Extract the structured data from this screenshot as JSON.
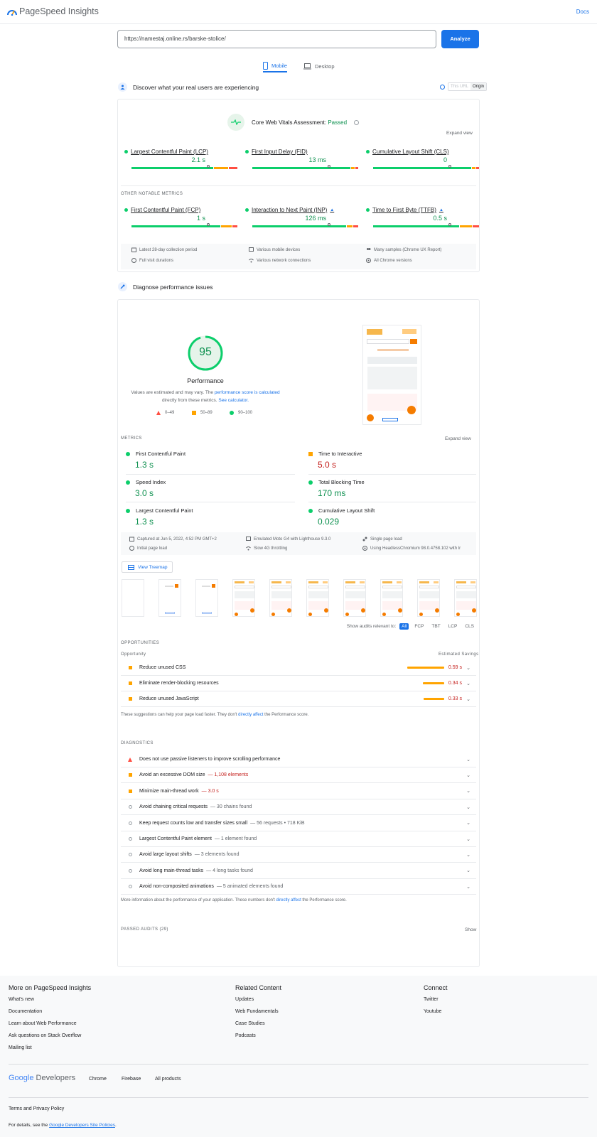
{
  "header": {
    "title": "PageSpeed Insights",
    "docs_label": "Docs"
  },
  "search": {
    "url": "https://namestaj.online.rs/barske-stolice/",
    "analyze_label": "Analyze"
  },
  "device_tabs": [
    {
      "label": "Mobile",
      "active": true
    },
    {
      "label": "Desktop",
      "active": false
    }
  ],
  "field": {
    "title": "Discover what your real users are experiencing",
    "toggle": {
      "this_url": "This URL",
      "origin": "Origin"
    },
    "assessment_label": "Core Web Vitals Assessment:",
    "assessment_result": "Passed",
    "expand_label": "Expand view",
    "core_metrics": [
      {
        "name": "Largest Contentful Paint (LCP)",
        "value": "2.1 s",
        "marker": 0.72,
        "dist": [
          0.78,
          0.14,
          0.08
        ]
      },
      {
        "name": "First Input Delay (FID)",
        "value": "13 ms",
        "marker": 0.72,
        "dist": [
          0.94,
          0.03,
          0.03
        ]
      },
      {
        "name": "Cumulative Layout Shift (CLS)",
        "value": "0",
        "marker": 0.72,
        "dist": [
          0.94,
          0.03,
          0.03
        ]
      }
    ],
    "other_label": "OTHER NOTABLE METRICS",
    "other_metrics": [
      {
        "name": "First Contentful Paint (FCP)",
        "value": "1 s",
        "marker": 0.72,
        "dist": [
          0.85,
          0.1,
          0.05
        ],
        "flag": false
      },
      {
        "name": "Interaction to Next Paint (INP)",
        "value": "126 ms",
        "marker": 0.72,
        "dist": [
          0.9,
          0.05,
          0.05
        ],
        "flag": true
      },
      {
        "name": "Time to First Byte (TTFB)",
        "value": "0.5 s",
        "marker": 0.72,
        "dist": [
          0.82,
          0.12,
          0.06
        ],
        "flag": true
      }
    ],
    "info": [
      "Latest 28-day collection period",
      "Various mobile devices",
      "Many samples (Chrome UX Report)",
      "Full visit durations",
      "Various network connections",
      "All Chrome versions"
    ]
  },
  "lab": {
    "title": "Diagnose performance issues",
    "score": "95",
    "score_fraction": 0.95,
    "score_label": "Performance",
    "note_a": "Values are estimated and may vary. The ",
    "note_link1": "performance score is calculated",
    "note_b": " directly from these metrics. ",
    "note_link2": "See calculator.",
    "legend": [
      "0–49",
      "50–89",
      "90–100"
    ],
    "metrics_label": "METRICS",
    "expand_label": "Expand view",
    "metrics": [
      {
        "name": "First Contentful Paint",
        "value": "1.3 s",
        "status": "good"
      },
      {
        "name": "Time to Interactive",
        "value": "5.0 s",
        "status": "average"
      },
      {
        "name": "Speed Index",
        "value": "3.0 s",
        "status": "good"
      },
      {
        "name": "Total Blocking Time",
        "value": "170 ms",
        "status": "good"
      },
      {
        "name": "Largest Contentful Paint",
        "value": "1.3 s",
        "status": "good"
      },
      {
        "name": "Cumulative Layout Shift",
        "value": "0.029",
        "status": "good"
      }
    ],
    "info": [
      "Captured at Jun 5, 2022, 4:52 PM GMT+2",
      "Emulated Moto G4 with Lighthouse 9.3.0",
      "Single page load",
      "Initial page load",
      "Slow 4G throttling",
      "Using HeadlessChromium 98.0.4758.102 with lr"
    ],
    "treemap_label": "View Treemap",
    "show_audits_label": "Show audits relevant to:",
    "audit_filters": [
      "All",
      "FCP",
      "TBT",
      "LCP",
      "CLS"
    ],
    "opportunities_label": "OPPORTUNITIES",
    "opp_col1": "Opportunity",
    "opp_col2": "Estimated Savings",
    "opportunities": [
      {
        "name": "Reduce unused CSS",
        "savings": "0.59 s",
        "bar": 0.59
      },
      {
        "name": "Eliminate render-blocking resources",
        "savings": "0.34 s",
        "bar": 0.34
      },
      {
        "name": "Reduce unused JavaScript",
        "savings": "0.33 s",
        "bar": 0.33
      }
    ],
    "opp_note_a": "These suggestions can help your page load faster. They don't ",
    "opp_note_link": "directly affect",
    "opp_note_b": " the Performance score.",
    "diagnostics_label": "DIAGNOSTICS",
    "diagnostics": [
      {
        "name": "Does not use passive listeners to improve scrolling performance",
        "detail": "",
        "status": "fail"
      },
      {
        "name": "Avoid an excessive DOM size",
        "detail": "— 1,108 elements",
        "status": "average"
      },
      {
        "name": "Minimize main-thread work",
        "detail": "— 3.0 s",
        "status": "average"
      },
      {
        "name": "Avoid chaining critical requests",
        "detail": "— 30 chains found",
        "status": "info"
      },
      {
        "name": "Keep request counts low and transfer sizes small",
        "detail": "— 56 requests • 718 KiB",
        "status": "info"
      },
      {
        "name": "Largest Contentful Paint element",
        "detail": "— 1 element found",
        "status": "info"
      },
      {
        "name": "Avoid large layout shifts",
        "detail": "— 3 elements found",
        "status": "info"
      },
      {
        "name": "Avoid long main-thread tasks",
        "detail": "— 4 long tasks found",
        "status": "info"
      },
      {
        "name": "Avoid non-composited animations",
        "detail": "— 5 animated elements found",
        "status": "info"
      }
    ],
    "diag_note_a": "More information about the performance of your application. These numbers don't ",
    "diag_note_link": "directly affect",
    "diag_note_b": " the Performance score.",
    "passed_label": "PASSED AUDITS (29)",
    "show_label": "Show"
  },
  "footer": {
    "col1": {
      "title": "More on PageSpeed Insights",
      "links": [
        "What's new",
        "Documentation",
        "Learn about Web Performance",
        "Ask questions on Stack Overflow",
        "Mailing list"
      ]
    },
    "col2": {
      "title": "Related Content",
      "links": [
        "Updates",
        "Web Fundamentals",
        "Case Studies",
        "Podcasts"
      ]
    },
    "col3": {
      "title": "Connect",
      "links": [
        "Twitter",
        "Youtube"
      ]
    },
    "brand_google": "Google",
    "brand_dev": " Developers",
    "nav": [
      "Chrome",
      "Firebase",
      "All products"
    ],
    "terms": "Terms and Privacy Policy",
    "details_a": "For details, see the ",
    "details_link": "Google Developers Site Policies",
    "details_b": "."
  },
  "colors": {
    "good": "#0cce6b",
    "average": "#ffa400",
    "poor": "#ff4e42",
    "accent": "#1a73e8"
  }
}
